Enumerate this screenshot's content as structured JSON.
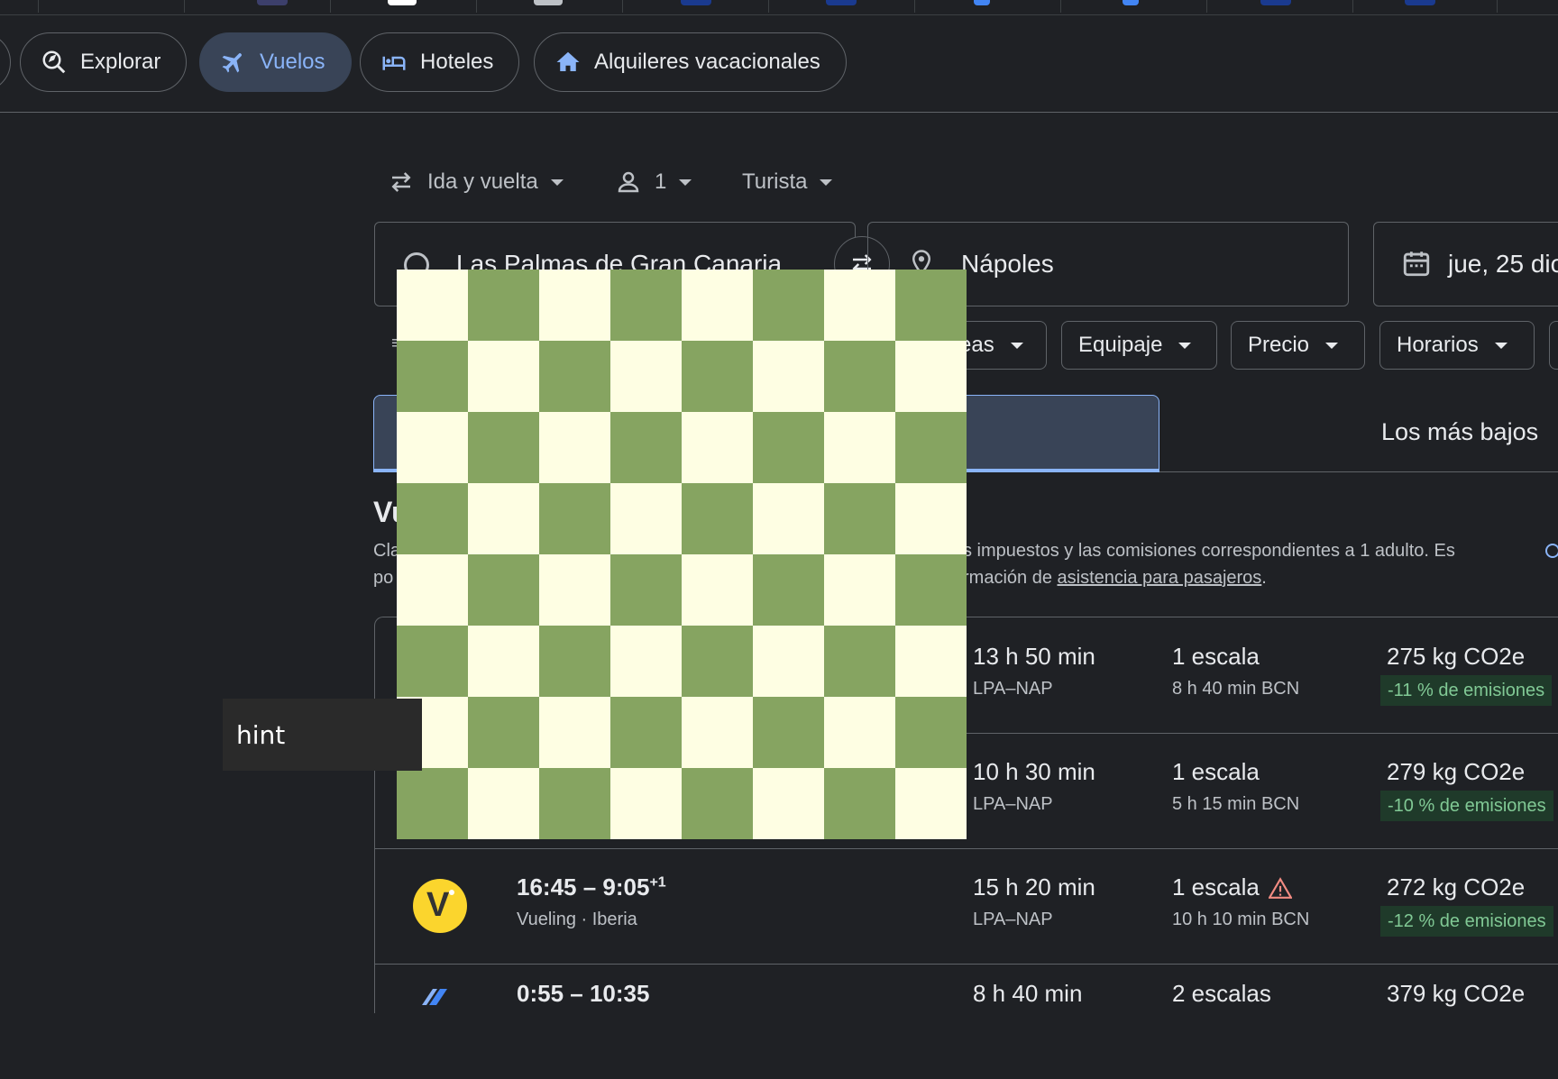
{
  "colors": {
    "background": "#1f2125",
    "accent": "#8ab4f8",
    "active_chip": "#394457",
    "board_light": "#fefee3",
    "board_dark": "#86a461",
    "emissions_green": "#81c995"
  },
  "nav": {
    "tabs": [
      {
        "label": "Explorar",
        "icon": "explore-search-icon"
      },
      {
        "label": "Vuelos",
        "icon": "airplane-icon",
        "active": true
      },
      {
        "label": "Hoteles",
        "icon": "bed-icon"
      },
      {
        "label": "Alquileres vacacionales",
        "icon": "house-icon"
      }
    ]
  },
  "search": {
    "trip_type": "Ida y vuelta",
    "passengers": "1",
    "cabin_class": "Turista",
    "origin": "Las Palmas de Gran Canaria",
    "destination": "Nápoles",
    "departure_date": "jue, 25 dic"
  },
  "filters": {
    "airlines_partial": "eas",
    "baggage": "Equipaje",
    "price": "Precio",
    "times": "Horarios"
  },
  "sort": {
    "lowest_label": "Los más bajos"
  },
  "results": {
    "title_partial": "Vu",
    "notice_left_1": "Cla",
    "notice_left_2": "po",
    "notice_right_1": "s impuestos y las comisiones correspondientes a 1 adulto. Es",
    "notice_right_2_prefix": "rmación de ",
    "notice_link": "asistencia para pasajeros",
    "notice_right_2_suffix": ".",
    "flights": [
      {
        "duration": "13 h 50 min",
        "route": "LPA–NAP",
        "stops": "1 escala",
        "stop_detail": "8 h 40 min BCN",
        "co2": "275 kg CO2e",
        "emissions": "-11 % de emisiones"
      },
      {
        "duration": "10 h 30 min",
        "route": "LPA–NAP",
        "stops": "1 escala",
        "stop_detail": "5 h 15 min BCN",
        "co2": "279 kg CO2e",
        "emissions": "-10 % de emisiones"
      },
      {
        "times": "16:45 – 9:05",
        "day_offset": "+1",
        "airline": "Vueling · Iberia",
        "logo_letter": "V",
        "duration": "15 h 20 min",
        "route": "LPA–NAP",
        "stops": "1 escala",
        "warning": "warning-triangle-icon",
        "stop_detail": "10 h 10 min BCN",
        "co2": "272 kg CO2e",
        "emissions": "-12 % de emisiones"
      },
      {
        "times": "0:55 – 10:35",
        "duration": "8 h 40 min",
        "stops": "2 escalas",
        "co2": "379 kg CO2e"
      }
    ]
  },
  "overlay": {
    "tooltip": "hint"
  }
}
